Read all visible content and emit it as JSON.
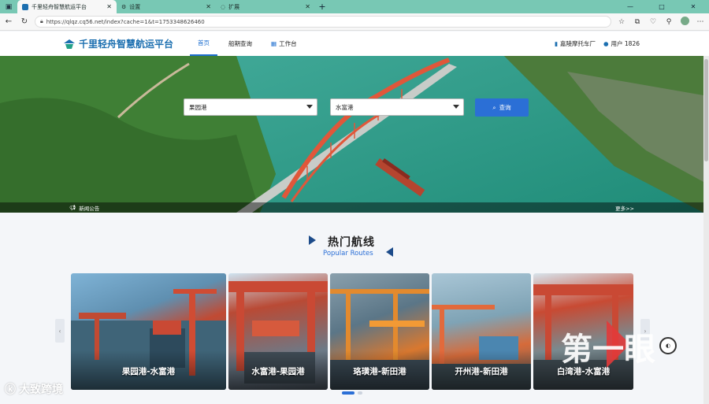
{
  "browser": {
    "tabs": [
      {
        "label": "千里轻舟智慧航运平台",
        "active": true
      },
      {
        "label": "设置",
        "active": false
      },
      {
        "label": "扩展",
        "active": false
      }
    ],
    "url": "https://qlqz.cq56.net/index?cache=1&t=1753348626460",
    "icons": [
      "sidebar-icon",
      "back-icon",
      "refresh-icon",
      "lock-icon",
      "star-icon",
      "extensions-icon",
      "profile-icon"
    ]
  },
  "site": {
    "logo_text": "千里轻舟智慧航运平台",
    "nav": [
      {
        "label": "首页",
        "active": true
      },
      {
        "label": "船期查询",
        "active": false
      },
      {
        "label": "工作台",
        "active": false
      }
    ],
    "company": "嘉陵摩托车厂",
    "user": "用户 1826"
  },
  "search": {
    "origin": "果园港",
    "destination": "水富港",
    "button_label": "查询"
  },
  "news": {
    "label": "新闻公告",
    "more": "更多>>"
  },
  "popular": {
    "title_cn": "热门航线",
    "title_en": "Popular Routes",
    "routes": [
      {
        "label": "果园港-水富港"
      },
      {
        "label": "水富港-果园港"
      },
      {
        "label": "珞璜港-新田港"
      },
      {
        "label": "开州港-新田港"
      },
      {
        "label": "白湾港-水富港"
      }
    ]
  },
  "watermarks": {
    "left": "大致跨境",
    "right": "第一眼"
  },
  "colors": {
    "accent": "#2b6fd6",
    "tabbar": "#78c8b4",
    "brand": "#1c6fb0"
  }
}
